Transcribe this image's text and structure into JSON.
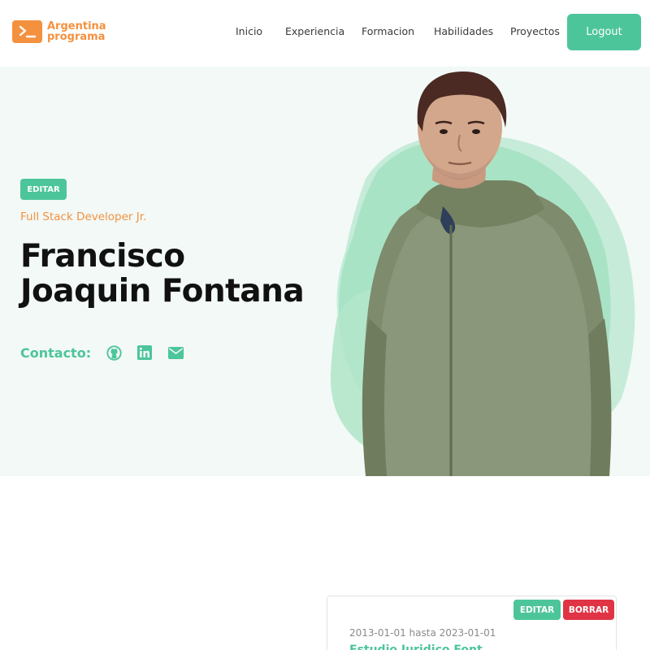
{
  "brand": {
    "line1": "Argentina",
    "line2": "programa",
    "icon": "terminal-prompt-icon",
    "color": "#f4913f"
  },
  "nav": {
    "items": [
      {
        "label": "Inicio"
      },
      {
        "label": "Experiencia"
      },
      {
        "label": "Formacion"
      },
      {
        "label": "Habilidades"
      },
      {
        "label": "Proyectos"
      }
    ],
    "logout_label": "Logout"
  },
  "hero": {
    "edit_label": "EDITAR",
    "role": "Full Stack Developer Jr.",
    "name_line1": "Francisco",
    "name_line2": "Joaquin Fontana",
    "contact_label": "Contacto:",
    "social_icons": [
      "github-icon",
      "linkedin-icon",
      "email-icon"
    ]
  },
  "education_card": {
    "edit_label": "EDITAR",
    "delete_label": "BORRAR",
    "dates": "2013-01-01 hasta 2023-01-01",
    "title": "Estudio Juridico Font..."
  },
  "colors": {
    "accent": "#4dc59a",
    "brand_orange": "#f4913f",
    "danger": "#e03444",
    "hero_bg": "#f2f9f6"
  }
}
